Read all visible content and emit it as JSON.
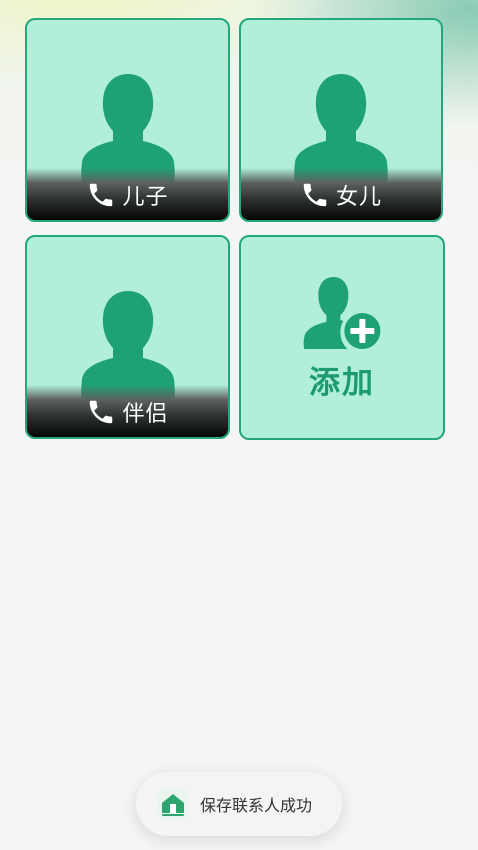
{
  "contacts": [
    {
      "label": "儿子"
    },
    {
      "label": "女儿"
    },
    {
      "label": "伴侣"
    }
  ],
  "add_card": {
    "label": "添加"
  },
  "toast": {
    "message": "保存联系人成功"
  },
  "icons": {
    "avatar": "person-silhouette-icon",
    "phone": "phone-icon",
    "add_contact": "add-person-icon",
    "app": "app-logo-icon"
  },
  "colors": {
    "card_fill": "#b1efd8",
    "card_border": "#24a77c",
    "accent_green": "#1fa176",
    "add_text": "#1e9a73"
  }
}
